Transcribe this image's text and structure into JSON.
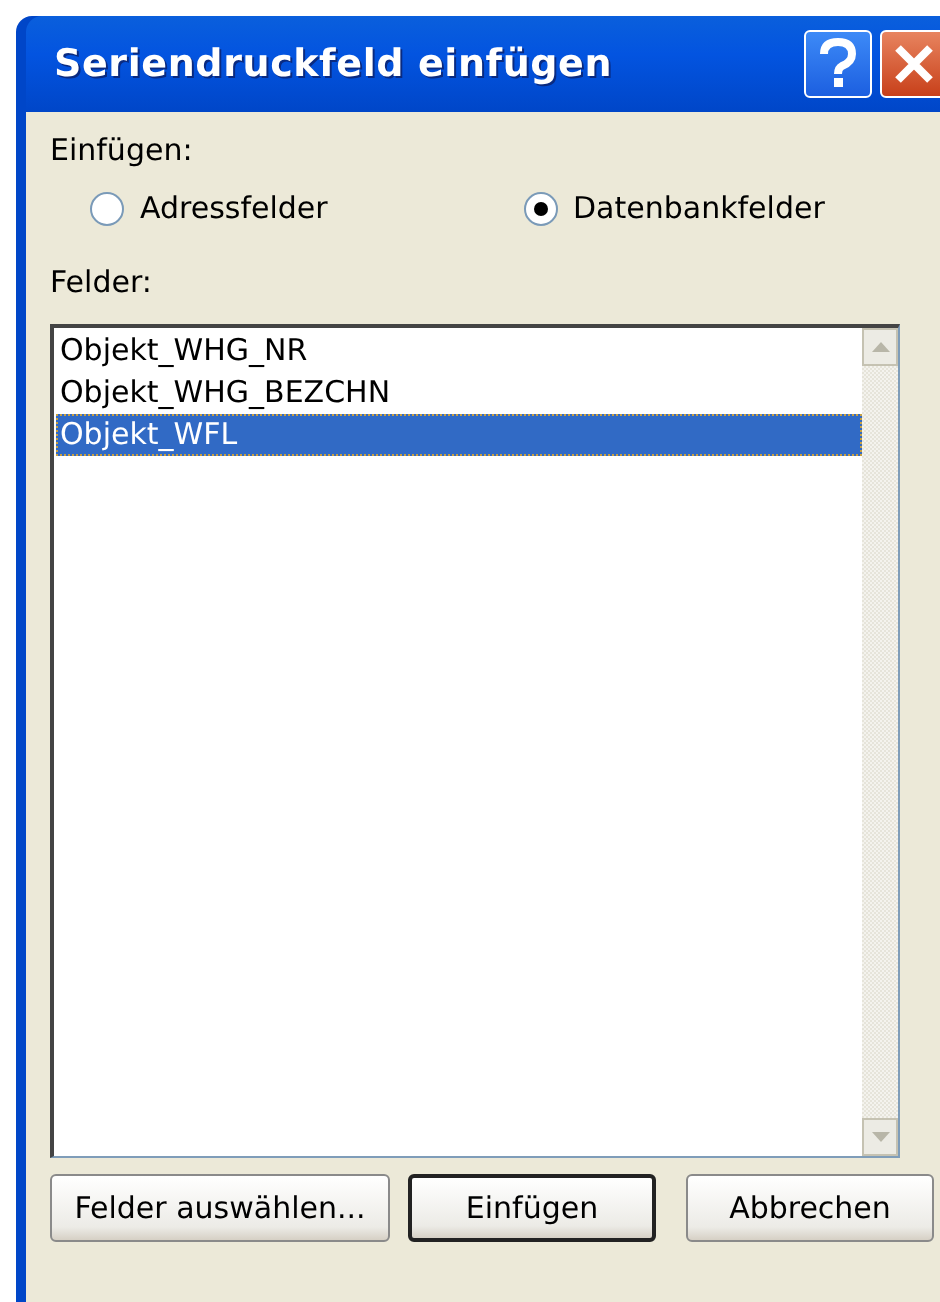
{
  "window": {
    "title": "Seriendruckfeld einfügen"
  },
  "insert_group": {
    "label": "Einfügen:",
    "options": [
      {
        "label": "Adressfelder",
        "selected": false
      },
      {
        "label": "Datenbankfelder",
        "selected": true
      }
    ]
  },
  "fields": {
    "label": "Felder:",
    "items": [
      {
        "label": "Objekt_WHG_NR",
        "selected": false
      },
      {
        "label": "Objekt_WHG_BEZCHN",
        "selected": false
      },
      {
        "label": "Objekt_WFL",
        "selected": true
      }
    ]
  },
  "buttons": [
    {
      "label": "Felder auswählen...",
      "default": false
    },
    {
      "label": "Einfügen",
      "default": true
    },
    {
      "label": "Abbrechen",
      "default": false
    }
  ]
}
